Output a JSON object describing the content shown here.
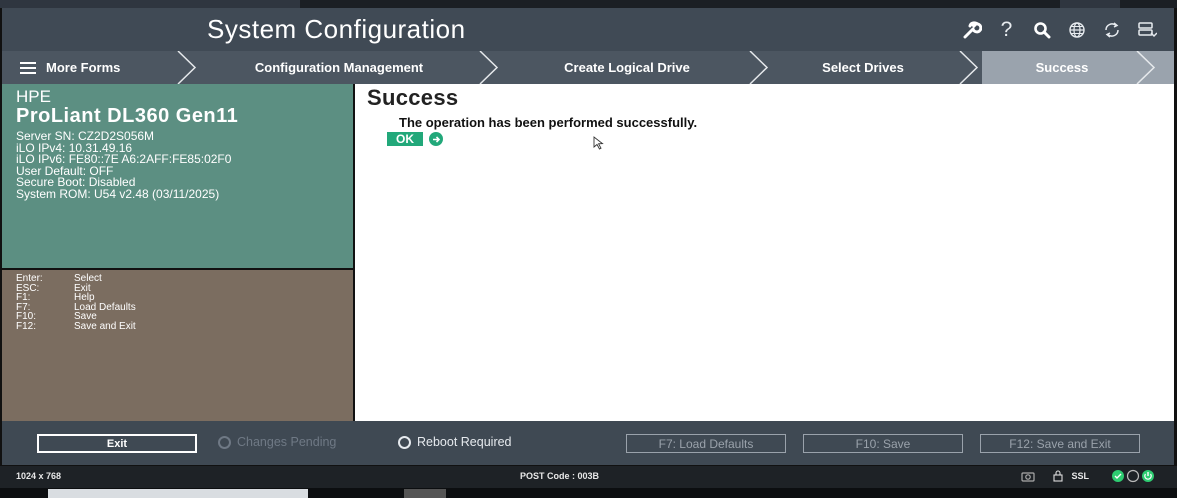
{
  "header": {
    "title": "System Configuration",
    "icons": [
      "wrench-icon",
      "help-icon",
      "search-icon",
      "globe-icon",
      "refresh-icon",
      "server-icon"
    ]
  },
  "nav": {
    "items": [
      {
        "label": "More Forms"
      },
      {
        "label": "Configuration Management"
      },
      {
        "label": "Create Logical Drive"
      },
      {
        "label": "Select Drives"
      },
      {
        "label": "Success"
      }
    ]
  },
  "server": {
    "brand": "HPE",
    "model": "ProLiant DL360 Gen11",
    "lines": [
      "Server SN: CZ2D2S056M",
      "iLO IPv4: 10.31.49.16",
      "iLO IPv6: FE80::7E A6:2AFF:FE85:02F0",
      "User Default: OFF",
      "Secure Boot: Disabled",
      "System ROM: U54 v2.48 (03/11/2025)"
    ]
  },
  "help": {
    "rows": [
      {
        "key": "Enter:",
        "action": "Select"
      },
      {
        "key": "ESC:",
        "action": "Exit"
      },
      {
        "key": "F1:",
        "action": "Help"
      },
      {
        "key": "F7:",
        "action": "Load Defaults"
      },
      {
        "key": "F10:",
        "action": "Save"
      },
      {
        "key": "F12:",
        "action": "Save and Exit"
      }
    ]
  },
  "main": {
    "heading": "Success",
    "message": "The operation has been performed successfully.",
    "ok_label": "OK"
  },
  "footer": {
    "exit_label": "Exit",
    "changes_pending": "Changes Pending",
    "reboot_required": "Reboot Required",
    "load_defaults": "F7: Load Defaults",
    "save": "F10: Save",
    "save_exit": "F12: Save and Exit"
  },
  "statusbar": {
    "resolution": "1024 x 768",
    "post_code": "POST Code : 003B",
    "ssl": "SSL"
  },
  "colors": {
    "header_bg": "#404a55",
    "info_panel": "#5c8f82",
    "help_panel": "#7b6d60",
    "accent_green": "#22a87a"
  }
}
